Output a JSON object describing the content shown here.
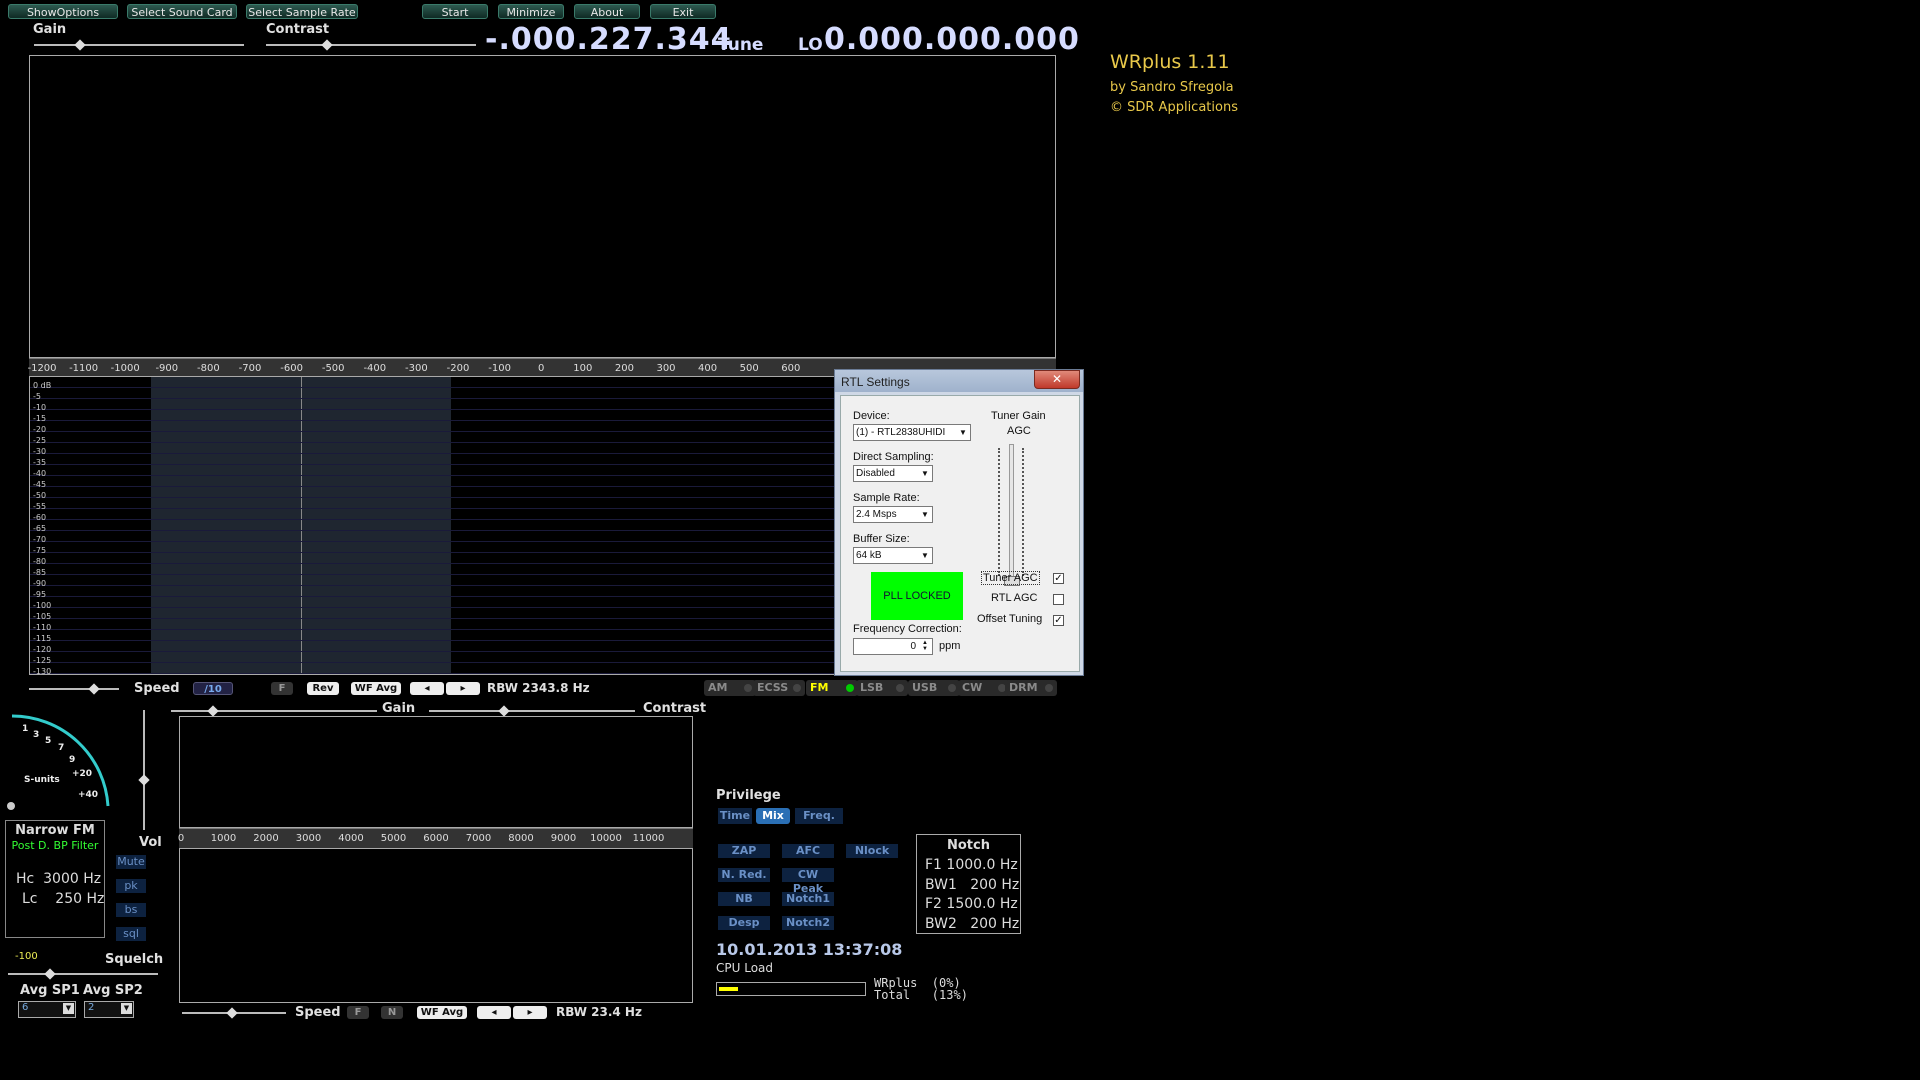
{
  "toolbar": {
    "show_options": "ShowOptions",
    "select_sound_card": "Select Sound Card",
    "select_sample_rate": "Select Sample Rate",
    "start": "Start",
    "minimize": "Minimize",
    "about": "About",
    "exit": "Exit"
  },
  "top": {
    "gain_label": "Gain",
    "contrast_label": "Contrast",
    "tune_value": "-.000.227.344",
    "tune_label": "Tune",
    "lo_label": "LO",
    "lo_value": "0.000.000.000"
  },
  "app_info": {
    "title": "WRplus 1.11",
    "author": "by Sandro Sfregola",
    "copyright": "© SDR Applications"
  },
  "spectrum": {
    "freq_ticks": [
      "-1200",
      "-1100",
      "-1000",
      "-900",
      "-800",
      "-700",
      "-600",
      "-500",
      "-400",
      "-300",
      "-200",
      "-100",
      "0",
      "100",
      "200",
      "300",
      "400",
      "500",
      "600"
    ],
    "db_ticks": [
      "0 dB",
      "-5",
      "-10",
      "-15",
      "-20",
      "-25",
      "-30",
      "-35",
      "-40",
      "-45",
      "-50",
      "-55",
      "-60",
      "-65",
      "-70",
      "-75",
      "-80",
      "-85",
      "-90",
      "-95",
      "-100",
      "-105",
      "-110",
      "-115",
      "-120",
      "-125",
      "-130"
    ]
  },
  "controls_row1": {
    "speed_label": "Speed",
    "speed_value": "/10",
    "f_btn": "F",
    "rev_btn": "Rev",
    "wfavg_btn": "WF Avg",
    "rbw": "RBW 2343.8 Hz"
  },
  "modes": [
    "AM",
    "ECSS",
    "FM",
    "LSB",
    "USB",
    "CW",
    "DRM"
  ],
  "active_mode": "FM",
  "smeter": {
    "label": "S-units",
    "ticks": [
      "1",
      "3",
      "5",
      "7",
      "9",
      "+20",
      "+40"
    ]
  },
  "filter_box": {
    "mode": "Narrow FM",
    "filter": "Post D. BP Filter",
    "hc": "Hc  3000 Hz",
    "lc": "Lc    250 Hz"
  },
  "audio_side": {
    "vol_label": "Vol",
    "buttons": [
      "Mute",
      "pk",
      "bs",
      "sql"
    ],
    "squelch_value": "-100",
    "squelch_label": "Squelch",
    "avg_sp1_label": "Avg SP1",
    "avg_sp2_label": "Avg SP2",
    "avg_sp1_value": "6",
    "avg_sp2_value": "2"
  },
  "audio_spectrum": {
    "gain_label": "Gain",
    "contrast_label": "Contrast",
    "freq_ticks": [
      "0",
      "1000",
      "2000",
      "3000",
      "4000",
      "5000",
      "6000",
      "7000",
      "8000",
      "9000",
      "10000",
      "11000"
    ],
    "speed_label": "Speed",
    "f_btn": "F",
    "n_btn": "N",
    "wfavg_btn": "WF Avg",
    "rbw": "RBW 23.4 Hz"
  },
  "privilege": {
    "label": "Privilege",
    "options": [
      "Time",
      "Mix",
      "Freq."
    ],
    "active": "Mix"
  },
  "dsp_buttons": [
    "ZAP",
    "AFC",
    "Nlock",
    "N. Red.",
    "CW Peak",
    "NB",
    "Notch1",
    "Desp",
    "Notch2"
  ],
  "notch": {
    "title": "Notch",
    "f1": "F1 1000.0 Hz",
    "bw1": "BW1   200 Hz",
    "f2": "F2 1500.0 Hz",
    "bw2": "BW2   200 Hz"
  },
  "status": {
    "datetime": "10.01.2013 13:37:08",
    "cpu_label": "CPU Load",
    "wrplus_load": "WRplus  (0%)",
    "total_load": "Total   (13%)",
    "cpu_load_fraction": 0.13
  },
  "rtl_dialog": {
    "title": "RTL Settings",
    "device_label": "Device:",
    "device_value": "(1) - RTL2838UHIDI",
    "direct_sampling_label": "Direct Sampling:",
    "direct_sampling_value": "Disabled",
    "sample_rate_label": "Sample Rate:",
    "sample_rate_value": "2.4 Msps",
    "buffer_size_label": "Buffer Size:",
    "buffer_size_value": "64 kB",
    "pll_status": "PLL LOCKED",
    "freq_correction_label": "Frequency Correction:",
    "freq_correction_value": "0",
    "ppm_label": "ppm",
    "tuner_gain_label": "Tuner Gain",
    "agc_label": "AGC",
    "tuner_agc_label": "Tuner AGC",
    "rtl_agc_label": "RTL AGC",
    "offset_tuning_label": "Offset Tuning",
    "tuner_agc_checked": "✓",
    "rtl_agc_checked": "",
    "offset_tuning_checked": "✓"
  },
  "colors": {
    "accent_green": "#00ff00",
    "dsp_button_bg": "#0d2240",
    "title_yellow": "#e8c84a"
  }
}
